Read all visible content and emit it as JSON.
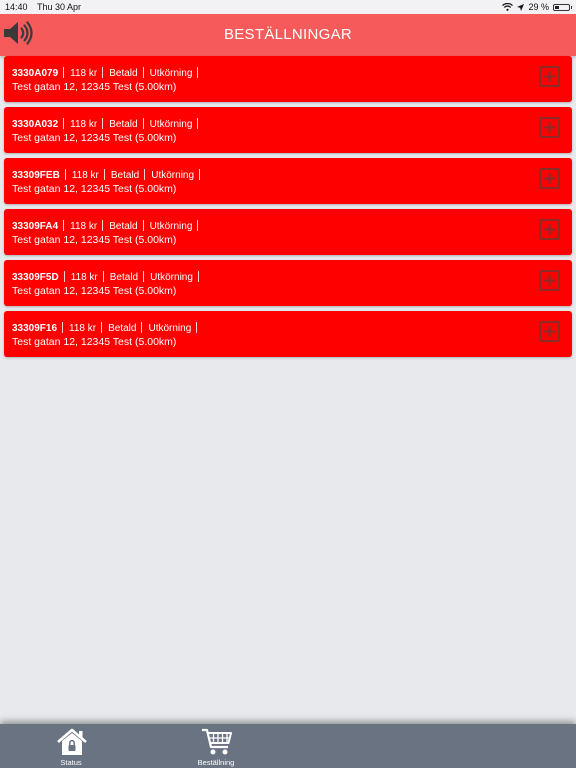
{
  "status_bar": {
    "time": "14:40",
    "date": "Thu 30 Apr",
    "battery": "29 %",
    "battery_level": 0.29
  },
  "header": {
    "title": "BESTÄLLNINGAR",
    "sound_icon": "speaker-icon"
  },
  "orders": [
    {
      "id": "3330A079",
      "price": "118 kr",
      "payment": "Betald",
      "delivery": "Utkörning",
      "address": "Test gatan 12, 12345 Test (5.00km)"
    },
    {
      "id": "3330A032",
      "price": "118 kr",
      "payment": "Betald",
      "delivery": "Utkörning",
      "address": "Test gatan 12, 12345 Test (5.00km)"
    },
    {
      "id": "33309FEB",
      "price": "118 kr",
      "payment": "Betald",
      "delivery": "Utkörning",
      "address": "Test gatan 12, 12345 Test (5.00km)"
    },
    {
      "id": "33309FA4",
      "price": "118 kr",
      "payment": "Betald",
      "delivery": "Utkörning",
      "address": "Test gatan 12, 12345 Test (5.00km)"
    },
    {
      "id": "33309F5D",
      "price": "118 kr",
      "payment": "Betald",
      "delivery": "Utkörning",
      "address": "Test gatan 12, 12345 Test (5.00km)"
    },
    {
      "id": "33309F16",
      "price": "118 kr",
      "payment": "Betald",
      "delivery": "Utkörning",
      "address": "Test gatan 12, 12345 Test (5.00km)"
    }
  ],
  "tabbar": {
    "tabs": [
      {
        "label": "Status",
        "icon": "home-lock-icon"
      },
      {
        "label": "Beställning",
        "icon": "cart-icon"
      }
    ]
  },
  "colors": {
    "header": "#f65a5a",
    "order_card": "#ff0000",
    "tabbar": "#6a7382",
    "background": "#e8e9ed"
  }
}
